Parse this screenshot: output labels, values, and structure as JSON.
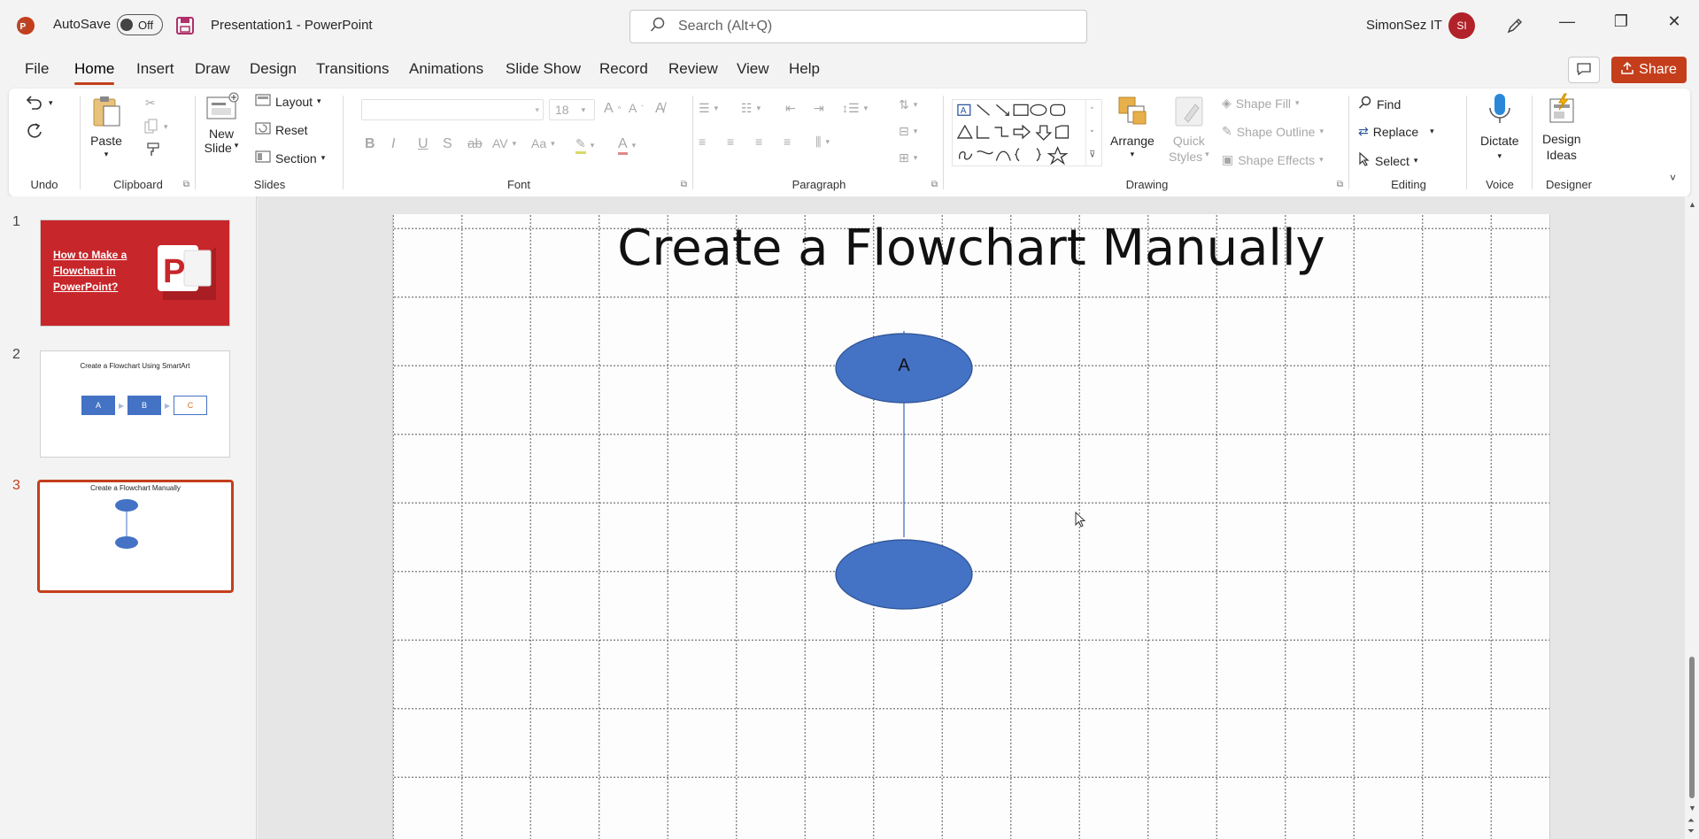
{
  "titlebar": {
    "autosave_label": "AutoSave",
    "autosave_state": "Off",
    "document_title": "Presentation1  -  PowerPoint",
    "search_placeholder": "Search (Alt+Q)",
    "user_name": "SimonSez IT",
    "user_initials": "SI"
  },
  "menu": {
    "items": [
      "File",
      "Home",
      "Insert",
      "Draw",
      "Design",
      "Transitions",
      "Animations",
      "Slide Show",
      "Record",
      "Review",
      "View",
      "Help"
    ],
    "active": "Home",
    "share_label": "Share"
  },
  "ribbon": {
    "undo": {
      "label": "Undo"
    },
    "clipboard": {
      "label": "Clipboard",
      "paste": "Paste"
    },
    "slides": {
      "label": "Slides",
      "new_slide": "New",
      "new_slide_2": "Slide",
      "layout": "Layout",
      "reset": "Reset",
      "section": "Section"
    },
    "font": {
      "label": "Font",
      "size": "18"
    },
    "paragraph": {
      "label": "Paragraph"
    },
    "drawing": {
      "label": "Drawing",
      "arrange": "Arrange",
      "quick_styles": "Quick",
      "quick_styles_2": "Styles",
      "shape_fill": "Shape Fill",
      "shape_outline": "Shape Outline",
      "shape_effects": "Shape Effects"
    },
    "editing": {
      "label": "Editing",
      "find": "Find",
      "replace": "Replace",
      "select": "Select"
    },
    "voice": {
      "label": "Voice",
      "dictate": "Dictate"
    },
    "designer": {
      "label": "Designer",
      "design_ideas": "Design",
      "design_ideas_2": "Ideas"
    }
  },
  "thumbnails": [
    {
      "number": "1",
      "text": "How to Make a Flowchart in PowerPoint?"
    },
    {
      "number": "2",
      "text": "Create a Flowchart Using SmartArt",
      "boxes": [
        "A",
        "B",
        "C"
      ]
    },
    {
      "number": "3",
      "text": "Create a Flowchart Manually"
    }
  ],
  "slide": {
    "title": "Create a Flowchart Manually",
    "shape_a_label": "A"
  },
  "colors": {
    "accent": "#c43e1c",
    "shape_fill": "#4472c4",
    "shape_border": "#2f5597"
  }
}
